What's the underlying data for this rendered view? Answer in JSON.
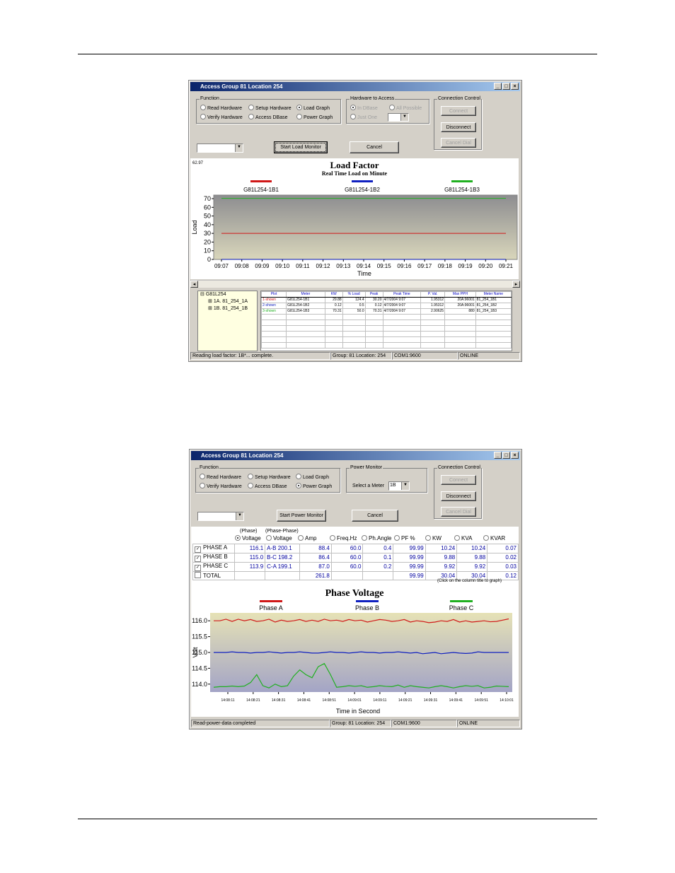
{
  "window1": {
    "title": "Access Group 81 Location 254",
    "function": {
      "title": "Function",
      "options": [
        "Read Hardware",
        "Setup Hardware",
        "Load Graph",
        "Verify Hardware",
        "Access DBase",
        "Power Graph"
      ],
      "selected": "Load Graph"
    },
    "hardware": {
      "title": "Hardware to Access",
      "options": [
        "In DBase",
        "All Possible",
        "Just One"
      ]
    },
    "connection": {
      "title": "Connection Control",
      "connect": "Connect",
      "disconnect": "Disconnect",
      "cancel_dial": "Cancel Dial"
    },
    "start_button": "Start Load Monitor",
    "cancel_button": "Cancel",
    "chart_value_label": "62.97",
    "status": {
      "message": "Reading load factor: 1B*... complete.",
      "location": "Group: 81 Location: 254",
      "port": "COM1:9600",
      "state": "ONLINE"
    },
    "tree": {
      "root": "G81L254",
      "children": [
        "1A. 81_254_1A",
        "1B. 81_254_1B"
      ]
    },
    "table": {
      "columns": [
        "Plot",
        "Meter",
        "KW",
        "% Load",
        "Peak",
        "Peak Time",
        "P. Val.",
        "Max PPH",
        "Meter Name"
      ],
      "rows": [
        [
          "1-shown",
          "G81L254-1B1",
          "29.88",
          "124.4",
          "30.20",
          "4/7/2004 9:07",
          "1.95312",
          "20A:96001",
          "81_254_1B1"
        ],
        [
          "2-shown",
          "G81L254-1B2",
          "0.12",
          "0.5",
          "0.12",
          "4/7/2004 9:07",
          "1.95312",
          "20A:96001",
          "81_254_1B2"
        ],
        [
          "3-shown",
          "G81L254-1B3",
          "70.31",
          "50.0",
          "70.31",
          "4/7/2004 9:07",
          "2.90625",
          "880",
          "81_254_1B3"
        ]
      ]
    }
  },
  "window2": {
    "title": "Access Group 81 Location 254",
    "function": {
      "title": "Function",
      "options": [
        "Read Hardware",
        "Setup Hardware",
        "Load Graph",
        "Verify Hardware",
        "Access DBase",
        "Power Graph"
      ],
      "selected": "Power Graph"
    },
    "power_monitor": {
      "title": "Power Monitor",
      "select_label": "Select a Meter",
      "selected_meter": "1B"
    },
    "connection": {
      "title": "Connection Control",
      "connect": "Connect",
      "disconnect": "Disconnect",
      "cancel_dial": "Cancel Dial"
    },
    "start_button": "Start Power Monitor",
    "cancel_button": "Cancel",
    "status": {
      "message": "Read-power-data completed",
      "location": "Group: 81 Location: 254",
      "port": "COM1:9600",
      "state": "ONLINE"
    },
    "phase_header": {
      "phase_label": "(Phase)",
      "phase_phase_label": "(Phase-Phase)",
      "columns": [
        "Voltage",
        "Voltage",
        "Amp",
        "Freq.Hz",
        "Ph.Angle",
        "PF %",
        "KW",
        "KVA",
        "KVAR"
      ],
      "selected": "Voltage"
    },
    "phase_rows": [
      {
        "name": "PHASE A",
        "checked": true,
        "voltage": "116.1",
        "pp_label": "A-B",
        "pp_voltage": "200.1",
        "amp": "88.4",
        "freq": "60.0",
        "angle": "0.4",
        "pf": "99.99",
        "kw": "10.24",
        "kva": "10.24",
        "kvar": "0.07"
      },
      {
        "name": "PHASE B",
        "checked": true,
        "voltage": "115.0",
        "pp_label": "B-C",
        "pp_voltage": "198.2",
        "amp": "86.4",
        "freq": "60.0",
        "angle": "0.1",
        "pf": "99.99",
        "kw": "9.88",
        "kva": "9.88",
        "kvar": "0.02"
      },
      {
        "name": "PHASE C",
        "checked": true,
        "voltage": "113.9",
        "pp_label": "C-A",
        "pp_voltage": "199.1",
        "amp": "87.0",
        "freq": "60.0",
        "angle": "0.2",
        "pf": "99.99",
        "kw": "9.92",
        "kva": "9.92",
        "kvar": "0.03"
      },
      {
        "name": "TOTAL",
        "checked": false,
        "voltage": "",
        "pp_label": "",
        "pp_voltage": "",
        "amp": "261.8",
        "freq": "",
        "angle": "",
        "pf": "99.99",
        "kw": "30.04",
        "kva": "30.04",
        "kvar": "0.12"
      }
    ],
    "hint": "(Click on the column title to graph)"
  },
  "colors": {
    "red": "#d01818",
    "blue": "#1020c0",
    "green": "#20b020",
    "window": "#d4d0c8"
  },
  "chart_data": [
    {
      "type": "line",
      "title": "Load Factor",
      "subtitle": "Real Time Load on Minute",
      "xlabel": "Time",
      "ylabel": "Load",
      "ylim": [
        0,
        70
      ],
      "yticks": [
        0,
        10,
        20,
        30,
        40,
        50,
        60,
        70
      ],
      "categories": [
        "09:07",
        "09:08",
        "09:09",
        "09:10",
        "09:11",
        "09:12",
        "09:13",
        "09:14",
        "09:15",
        "09:16",
        "09:17",
        "09:18",
        "09:19",
        "09:20",
        "09:21"
      ],
      "series": [
        {
          "name": "G81L254-1B1",
          "color": "#d01818",
          "values": [
            30,
            30,
            30,
            30,
            30,
            30,
            30,
            30,
            30,
            30,
            30,
            30,
            30,
            30,
            30
          ]
        },
        {
          "name": "G81L254-1B2",
          "color": "#1020c0",
          "values": [
            0.1,
            0.1,
            0.1,
            0.1,
            0.1,
            0.1,
            0.1,
            0.1,
            0.1,
            0.1,
            0.1,
            0.1,
            0.1,
            0.1,
            0.1
          ]
        },
        {
          "name": "G81L254-1B3",
          "color": "#20b020",
          "values": [
            70.3,
            70.3,
            70.3,
            70.3,
            70.3,
            70.3,
            70.3,
            70.3,
            70.3,
            70.3,
            70.3,
            70.3,
            70.3,
            70.3,
            70.3
          ]
        }
      ],
      "legend": "top"
    },
    {
      "type": "line",
      "title": "Phase Voltage",
      "xlabel": "Time in Second",
      "ylabel": "Volt",
      "ylim": [
        113.75,
        116.25
      ],
      "yticks": [
        "114.0",
        "114.5",
        "115.0",
        "115.5",
        "116.0"
      ],
      "xticks": [
        "14:08:11",
        "14:08:21",
        "14:08:31",
        "14:08:41",
        "14:08:51",
        "14:09:01",
        "14:09:11",
        "14:09:21",
        "14:09:31",
        "14:09:41",
        "14:09:51",
        "14:10:01"
      ],
      "series": [
        {
          "name": "Phase A",
          "color": "#d01818",
          "values": [
            116.0,
            116.0,
            116.05,
            115.98,
            116.05,
            116.0,
            116.04,
            115.98,
            116.0,
            116.05,
            115.96,
            116.02,
            115.98,
            116.0,
            116.04,
            115.98,
            116.02,
            115.98,
            116.05,
            116.0,
            116.02,
            115.98,
            116.04,
            116.0,
            116.02,
            115.96,
            116.0,
            116.04,
            116.02,
            115.98,
            116.0,
            116.04,
            115.96,
            116.0,
            115.98,
            115.94,
            115.96,
            116.0,
            115.98,
            116.04,
            115.96,
            116.0,
            115.96,
            115.98,
            116.0,
            115.97,
            115.98,
            116.02,
            116.06
          ]
        },
        {
          "name": "Phase B",
          "color": "#1020c0",
          "values": [
            115.0,
            115.0,
            115.0,
            115.02,
            115.0,
            115.0,
            114.98,
            115.0,
            115.0,
            115.02,
            115.0,
            114.98,
            115.0,
            115.0,
            115.02,
            115.0,
            114.98,
            114.98,
            115.0,
            115.02,
            115.0,
            115.0,
            114.98,
            115.0,
            115.02,
            115.0,
            115.0,
            114.98,
            115.0,
            115.0,
            115.02,
            115.0,
            114.98,
            115.0,
            114.96,
            114.98,
            115.0,
            114.96,
            114.98,
            115.0,
            114.98,
            114.97,
            114.98,
            115.02,
            115.0,
            115.0,
            115.0,
            115.0,
            115.0
          ]
        },
        {
          "name": "Phase C",
          "color": "#20b020",
          "values": [
            113.9,
            113.92,
            113.92,
            113.94,
            113.92,
            113.94,
            114.05,
            114.3,
            113.95,
            113.88,
            114.0,
            113.92,
            113.95,
            114.25,
            114.45,
            114.3,
            114.2,
            114.55,
            114.65,
            114.3,
            113.9,
            113.92,
            113.95,
            113.93,
            113.95,
            113.9,
            113.92,
            113.95,
            113.93,
            113.92,
            113.97,
            113.9,
            113.95,
            113.92,
            113.9,
            113.88,
            113.92,
            113.95,
            113.92,
            113.88,
            113.92,
            113.95,
            113.93,
            113.95,
            113.88,
            113.9,
            113.94,
            113.93,
            113.92
          ]
        }
      ],
      "legend": "top"
    }
  ]
}
